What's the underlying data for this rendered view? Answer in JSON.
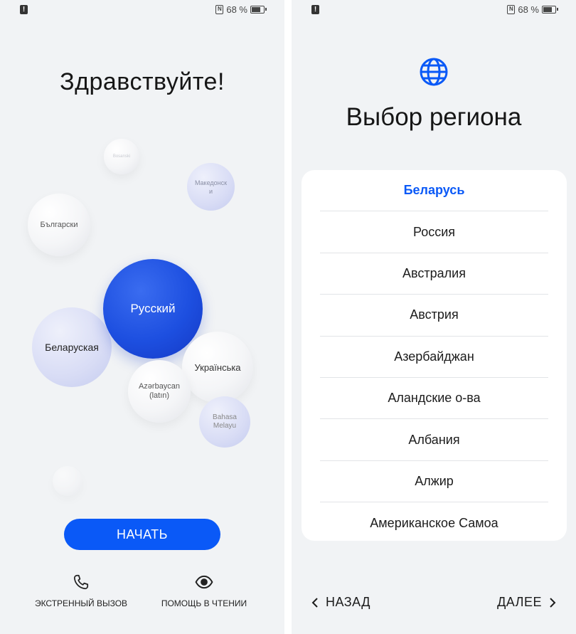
{
  "status_bar": {
    "battery": "68 %"
  },
  "welcome": {
    "greeting": "Здравствуйте!",
    "languages": [
      "Русский",
      "Беларуская",
      "Български",
      "Македонски",
      "Українська",
      "Azərbaycan (latın)",
      "Bahasa Melayu",
      "Bosanski"
    ],
    "start_label": "НАЧАТЬ",
    "emergency_label": "ЭКСТРЕННЫЙ ВЫЗОВ",
    "accessibility_label": "ПОМОЩЬ В ЧТЕНИИ",
    "colors": {
      "accent": "#0a59f7",
      "selected_bubble": "#1d4fe0"
    }
  },
  "region": {
    "title": "Выбор региона",
    "selected": "Беларусь",
    "items": [
      "Беларусь",
      "Россия",
      "Австралия",
      "Австрия",
      "Азербайджан",
      "Аландские о-ва",
      "Албания",
      "Алжир",
      "Американское Самоа"
    ],
    "back_label": "НАЗАД",
    "next_label": "ДАЛЕЕ",
    "icons": {
      "title": "globe-icon",
      "back": "chevron-left-icon",
      "next": "chevron-right-icon"
    }
  }
}
